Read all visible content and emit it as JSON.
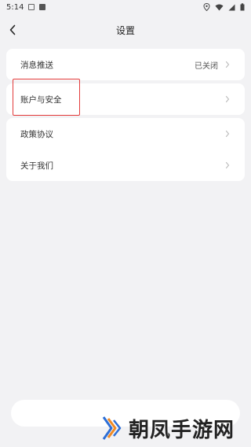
{
  "status_bar": {
    "time": "5:14"
  },
  "header": {
    "title": "设置"
  },
  "settings_groups": [
    {
      "items": [
        {
          "label": "消息推送",
          "value": "已关闭"
        }
      ]
    },
    {
      "items": [
        {
          "label": "账户与安全",
          "value": ""
        }
      ]
    },
    {
      "items": [
        {
          "label": "政策协议",
          "value": ""
        },
        {
          "label": "关于我们",
          "value": ""
        }
      ]
    }
  ],
  "watermark": {
    "text": "朝凤手游网"
  },
  "colors": {
    "background": "#f2f2f4",
    "card": "#ffffff",
    "highlight_box": "#e23a3a",
    "watermark_blue": "#2e6fd6",
    "watermark_orange": "#f08a24"
  }
}
